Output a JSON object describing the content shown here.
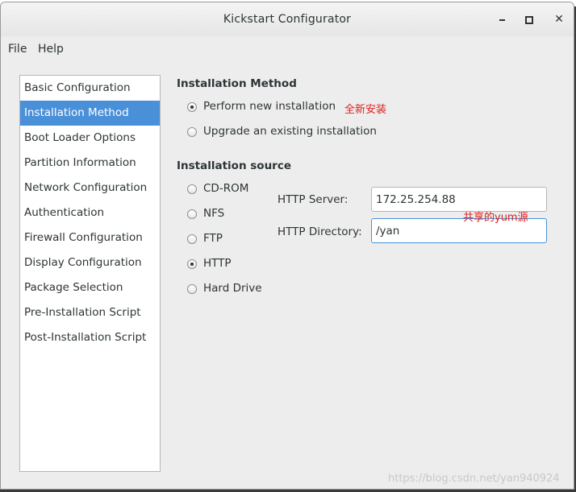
{
  "window": {
    "title": "Kickstart Configurator"
  },
  "menu": {
    "file": "File",
    "help": "Help"
  },
  "sidebar": {
    "items": [
      {
        "label": "Basic Configuration"
      },
      {
        "label": "Installation Method",
        "selected": true
      },
      {
        "label": "Boot Loader Options"
      },
      {
        "label": "Partition Information"
      },
      {
        "label": "Network Configuration"
      },
      {
        "label": "Authentication"
      },
      {
        "label": "Firewall Configuration"
      },
      {
        "label": "Display Configuration"
      },
      {
        "label": "Package Selection"
      },
      {
        "label": "Pre-Installation Script"
      },
      {
        "label": "Post-Installation Script"
      }
    ]
  },
  "installation_method": {
    "title": "Installation Method",
    "options": [
      {
        "label": "Perform new installation",
        "checked": true
      },
      {
        "label": "Upgrade an existing installation",
        "checked": false
      }
    ],
    "annotation": "全新安装"
  },
  "installation_source": {
    "title": "Installation source",
    "options": [
      {
        "label": "CD-ROM",
        "checked": false
      },
      {
        "label": "NFS",
        "checked": false
      },
      {
        "label": "FTP",
        "checked": false
      },
      {
        "label": "HTTP",
        "checked": true
      },
      {
        "label": "Hard Drive",
        "checked": false
      }
    ],
    "http_server_label": "HTTP Server:",
    "http_server_value": "172.25.254.88",
    "http_directory_label": "HTTP Directory:",
    "http_directory_value": "/yan",
    "annotation": "共享的yum源"
  },
  "watermark": "https://blog.csdn.net/yan940924",
  "colors": {
    "selection": "#4a90d9",
    "annotation": "#e0201c"
  }
}
